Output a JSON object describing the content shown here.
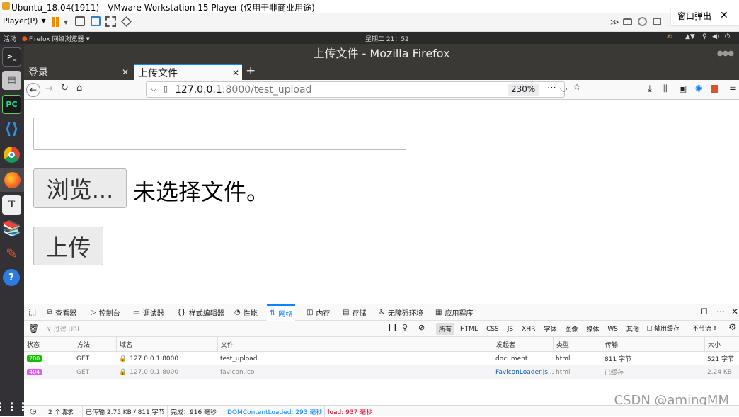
{
  "vm": {
    "title": "Ubuntu_18.04(1911) - VMware Workstation 15 Player (仅用于非商业用途)",
    "player_menu": "Player(P)",
    "popup_label": "窗口弹出"
  },
  "gnome": {
    "activities": "活动",
    "app_menu": "Firefox 网络浏览器",
    "clock": "星期二 21：52"
  },
  "browser": {
    "window_title": "上传文件 - Mozilla Firefox",
    "tabs": [
      {
        "label": "登录",
        "active": false
      },
      {
        "label": "上传文件",
        "active": true
      }
    ],
    "url_host": "127.0.0.1",
    "url_path": ":8000/test_upload",
    "zoom": "230%"
  },
  "page": {
    "text_input_value": "",
    "browse_button": "浏览...",
    "no_file_text": "未选择文件。",
    "upload_button": "上传"
  },
  "devtools": {
    "tabs": [
      "查看器",
      "控制台",
      "调试器",
      "样式编辑器",
      "性能",
      "网络",
      "内存",
      "存储",
      "无障碍环境",
      "应用程序"
    ],
    "active_tab": "网络",
    "filter_placeholder": "过滤 URL",
    "type_filters": [
      "所有",
      "HTML",
      "CSS",
      "JS",
      "XHR",
      "字体",
      "图像",
      "媒体",
      "WS",
      "其他"
    ],
    "disable_cache": "禁用缓存",
    "throttle": "不节流",
    "columns": [
      "状态",
      "方法",
      "域名",
      "文件",
      "发起者",
      "类型",
      "传输",
      "大小"
    ],
    "requests": [
      {
        "status": "200",
        "status_color": "#12bc00",
        "method": "GET",
        "domain": "127.0.0.1:8000",
        "file": "test_upload",
        "initiator": "document",
        "type": "html",
        "transferred": "811 字节",
        "size": "521 字节",
        "cached": false
      },
      {
        "status": "404",
        "status_color": "#d861f1",
        "method": "GET",
        "domain": "127.0.0.1:8000",
        "file": "favicon.ico",
        "initiator": "FaviconLoader.js...",
        "type": "html",
        "transferred": "已缓存",
        "size": "2.24 KB",
        "cached": true
      }
    ],
    "status_bar": {
      "requests": "2 个请求",
      "transferred": "已传输 2.75 KB / 811 字节",
      "finish": "完成：916 毫秒",
      "dom_content_loaded": "DOMContentLoaded: 293 毫秒",
      "load": "load: 937 毫秒"
    }
  },
  "watermark": "CSDN @amingMM"
}
